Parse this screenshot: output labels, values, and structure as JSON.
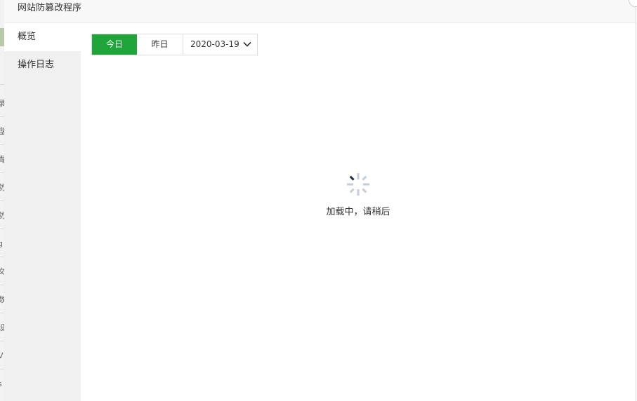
{
  "dialog": {
    "title": "网站防篡改程序"
  },
  "sidebar": {
    "items": [
      {
        "label": "概览",
        "active": true
      },
      {
        "label": "操作日志",
        "active": false
      }
    ]
  },
  "toolbar": {
    "today_label": "今日",
    "yesterday_label": "昨日",
    "date_value": "2020-03-19",
    "accent_color": "#20a53a"
  },
  "loading": {
    "text": "加载中，请稍后"
  },
  "background_page": {
    "glyphs": [
      "录",
      "盘",
      "青",
      "防",
      "防",
      "g",
      "文",
      "数",
      "设",
      "V",
      "s"
    ]
  }
}
